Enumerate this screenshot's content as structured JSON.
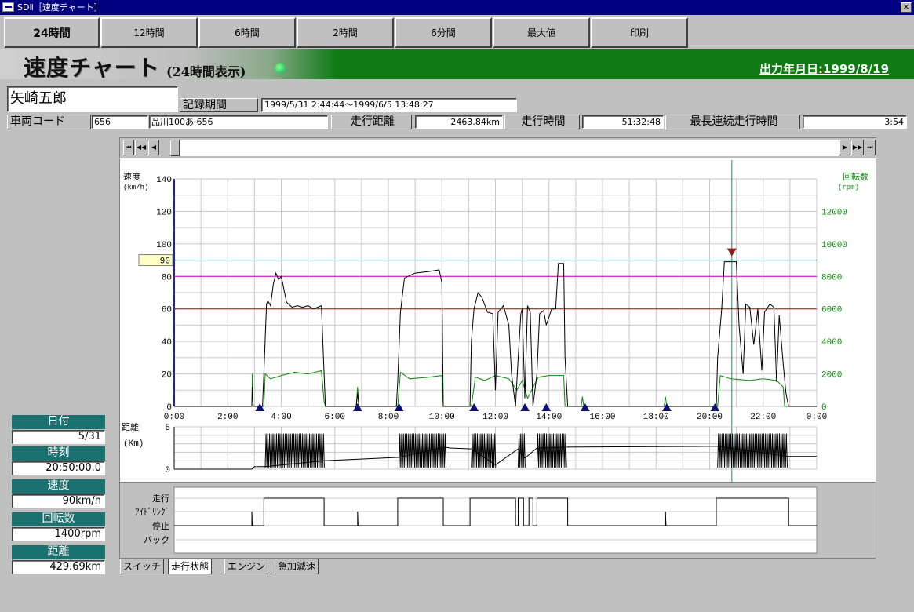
{
  "window": {
    "title": "SDⅡ［速度チャート］",
    "close": "×"
  },
  "toolbar": {
    "buttons": [
      "24時間",
      "12時間",
      "6時間",
      "2時間",
      "6分間",
      "最大値",
      "印刷"
    ],
    "active_index": 0
  },
  "banner": {
    "title": "速度チャート",
    "subtitle": "(24時間表示)",
    "output_date": "出力年月日:1999/8/19"
  },
  "record": {
    "driver_name": "矢崎五郎",
    "period_label": "記録期間",
    "period_value": "1999/5/31 2:44:44～1999/6/5 13:48:27",
    "vehicle_code_label": "車両コード",
    "vehicle_code": "656",
    "plate": "品川100あ 656",
    "distance_label": "走行距離",
    "distance_value": "2463.84km",
    "drive_time_label": "走行時間",
    "drive_time_value": "51:32:48",
    "max_continuous_label": "最長連続走行時間",
    "max_continuous_value": "3:54"
  },
  "side_info": {
    "date_label": "日付",
    "date_value": "5/31",
    "time_label": "時刻",
    "time_value": "20:50:00.0",
    "speed_label": "速度",
    "speed_value": "90km/h",
    "rpm_label": "回転数",
    "rpm_value": "1400rpm",
    "distance_label": "距離",
    "distance_value": "429.69km"
  },
  "chart_data": {
    "type": "line",
    "left_axis": {
      "label": "速度",
      "unit": "(km/h)",
      "ticks": [
        0,
        20,
        40,
        60,
        80,
        100,
        120,
        140
      ],
      "range": [
        0,
        140
      ]
    },
    "right_axis": {
      "label": "回転数",
      "unit": "(rpm)",
      "ticks": [
        0,
        2000,
        4000,
        6000,
        8000,
        10000,
        12000
      ],
      "range": [
        0,
        14000
      ]
    },
    "x_ticks": [
      "0:00",
      "2:00",
      "4:00",
      "6:00",
      "8:00",
      "10:00",
      "12:00",
      "14:00",
      "16:00",
      "18:00",
      "20:00",
      "22:00",
      "0:00"
    ],
    "x_range_hours": [
      0,
      24
    ],
    "threshold_lines": [
      {
        "value": 90,
        "color": "#2a8080"
      },
      {
        "value": 80,
        "color": "#cc00cc"
      },
      {
        "value": 60,
        "color": "#cc0000"
      }
    ],
    "marker_value": "90",
    "cursor_hour": 20.83,
    "start_markers_hours": [
      3.2,
      6.85,
      8.4,
      11.2,
      13.1,
      13.9,
      15.35,
      18.4,
      20.2
    ],
    "speed_series": [
      [
        0,
        0
      ],
      [
        2.9,
        0
      ],
      [
        2.92,
        12
      ],
      [
        2.95,
        0
      ],
      [
        3.3,
        0
      ],
      [
        3.35,
        20
      ],
      [
        3.45,
        63
      ],
      [
        3.5,
        65
      ],
      [
        3.6,
        62
      ],
      [
        3.7,
        75
      ],
      [
        3.8,
        82
      ],
      [
        3.9,
        78
      ],
      [
        4.0,
        80
      ],
      [
        4.1,
        72
      ],
      [
        4.2,
        64
      ],
      [
        4.4,
        61
      ],
      [
        4.6,
        62
      ],
      [
        4.8,
        61
      ],
      [
        5.0,
        62
      ],
      [
        5.2,
        60
      ],
      [
        5.5,
        62
      ],
      [
        5.6,
        20
      ],
      [
        5.65,
        0
      ],
      [
        6.8,
        0
      ],
      [
        6.85,
        8
      ],
      [
        6.9,
        0
      ],
      [
        8.3,
        0
      ],
      [
        8.35,
        15
      ],
      [
        8.45,
        58
      ],
      [
        8.6,
        79
      ],
      [
        9.0,
        82
      ],
      [
        9.5,
        83
      ],
      [
        9.9,
        84
      ],
      [
        10.0,
        76
      ],
      [
        10.05,
        0
      ],
      [
        11.05,
        0
      ],
      [
        11.1,
        40
      ],
      [
        11.2,
        60
      ],
      [
        11.35,
        70
      ],
      [
        11.5,
        67
      ],
      [
        11.7,
        58
      ],
      [
        11.9,
        57
      ],
      [
        12.0,
        10
      ],
      [
        12.1,
        58
      ],
      [
        12.3,
        62
      ],
      [
        12.5,
        50
      ],
      [
        12.6,
        20
      ],
      [
        12.75,
        0
      ],
      [
        12.85,
        30
      ],
      [
        12.95,
        57
      ],
      [
        13.0,
        60
      ],
      [
        13.1,
        5
      ],
      [
        13.2,
        62
      ],
      [
        13.3,
        58
      ],
      [
        13.4,
        0
      ],
      [
        13.55,
        20
      ],
      [
        13.65,
        57
      ],
      [
        13.8,
        59
      ],
      [
        13.9,
        50
      ],
      [
        14.1,
        60
      ],
      [
        14.25,
        60
      ],
      [
        14.35,
        88
      ],
      [
        14.55,
        88
      ],
      [
        14.6,
        30
      ],
      [
        14.7,
        0
      ],
      [
        15.2,
        0
      ],
      [
        15.25,
        0
      ],
      [
        20.25,
        0
      ],
      [
        20.3,
        30
      ],
      [
        20.45,
        60
      ],
      [
        20.55,
        89
      ],
      [
        21.0,
        89
      ],
      [
        21.1,
        50
      ],
      [
        21.25,
        20
      ],
      [
        21.35,
        63
      ],
      [
        21.5,
        61
      ],
      [
        21.65,
        38
      ],
      [
        21.8,
        60
      ],
      [
        21.95,
        22
      ],
      [
        22.05,
        58
      ],
      [
        22.25,
        63
      ],
      [
        22.4,
        61
      ],
      [
        22.5,
        15
      ],
      [
        22.6,
        56
      ],
      [
        22.75,
        26
      ],
      [
        22.85,
        8
      ],
      [
        22.95,
        0
      ],
      [
        24,
        0
      ]
    ],
    "rpm_series": [
      [
        0,
        0
      ],
      [
        2.9,
        0
      ],
      [
        2.92,
        2000
      ],
      [
        2.95,
        0
      ],
      [
        3.35,
        0
      ],
      [
        3.4,
        2000
      ],
      [
        3.6,
        1700
      ],
      [
        4.0,
        1900
      ],
      [
        4.5,
        2100
      ],
      [
        5.0,
        2000
      ],
      [
        5.5,
        2200
      ],
      [
        5.6,
        300
      ],
      [
        5.65,
        0
      ],
      [
        6.8,
        0
      ],
      [
        6.85,
        1200
      ],
      [
        6.9,
        0
      ],
      [
        8.35,
        0
      ],
      [
        8.45,
        2100
      ],
      [
        8.8,
        1700
      ],
      [
        9.5,
        1800
      ],
      [
        10.0,
        1900
      ],
      [
        10.05,
        0
      ],
      [
        11.1,
        0
      ],
      [
        11.25,
        1800
      ],
      [
        11.6,
        1600
      ],
      [
        12.0,
        1900
      ],
      [
        12.5,
        1700
      ],
      [
        12.8,
        1000
      ],
      [
        13.0,
        1600
      ],
      [
        13.2,
        500
      ],
      [
        13.6,
        1800
      ],
      [
        14.0,
        1900
      ],
      [
        14.55,
        1900
      ],
      [
        14.6,
        0
      ],
      [
        15.2,
        0
      ],
      [
        15.25,
        600
      ],
      [
        15.3,
        0
      ],
      [
        18.3,
        0
      ],
      [
        18.35,
        600
      ],
      [
        18.4,
        0
      ],
      [
        20.3,
        0
      ],
      [
        20.4,
        1900
      ],
      [
        20.8,
        1700
      ],
      [
        21.5,
        1600
      ],
      [
        22.0,
        1700
      ],
      [
        22.5,
        1600
      ],
      [
        22.75,
        1200
      ],
      [
        22.8,
        0
      ],
      [
        24,
        0
      ]
    ],
    "distance_axis": {
      "label": "距離",
      "unit": "(Km)",
      "ticks": [
        0,
        5
      ],
      "range": [
        0,
        5
      ]
    },
    "distance_bursts": [
      [
        3.4,
        5.6
      ],
      [
        8.4,
        10.1
      ],
      [
        11.1,
        12.0
      ],
      [
        12.85,
        13.1
      ],
      [
        13.55,
        14.6
      ],
      [
        20.3,
        22.9
      ]
    ],
    "distance_steps": [
      [
        0,
        0
      ],
      [
        2.9,
        0
      ],
      [
        3.0,
        0.3
      ],
      [
        3.4,
        0.3
      ],
      [
        5.6,
        1.0
      ],
      [
        8.4,
        1.4
      ],
      [
        10.1,
        2.6
      ],
      [
        10.3,
        2.5
      ],
      [
        11.1,
        2.4
      ],
      [
        12.0,
        0.5
      ],
      [
        12.85,
        2.4
      ],
      [
        13.1,
        1.3
      ],
      [
        13.55,
        2.5
      ],
      [
        14.6,
        2.6
      ],
      [
        20.3,
        2.7
      ],
      [
        22.9,
        1.5
      ],
      [
        24,
        1.5
      ]
    ],
    "state_labels": [
      "走行",
      "ｱｲﾄﾞﾘﾝｸﾞ",
      "停止",
      "バック"
    ],
    "state_series": [
      [
        0,
        2
      ],
      [
        2.9,
        2
      ],
      [
        2.9,
        1
      ],
      [
        2.92,
        2
      ],
      [
        3.35,
        2
      ],
      [
        3.35,
        0
      ],
      [
        5.6,
        0
      ],
      [
        5.6,
        2
      ],
      [
        6.85,
        2
      ],
      [
        6.85,
        1
      ],
      [
        6.87,
        2
      ],
      [
        8.35,
        2
      ],
      [
        8.35,
        0
      ],
      [
        10.05,
        0
      ],
      [
        10.05,
        2
      ],
      [
        11.05,
        2
      ],
      [
        11.05,
        0
      ],
      [
        12.75,
        0
      ],
      [
        12.75,
        2
      ],
      [
        12.85,
        2
      ],
      [
        12.85,
        0
      ],
      [
        13.05,
        0
      ],
      [
        13.05,
        2
      ],
      [
        13.25,
        2
      ],
      [
        13.25,
        0
      ],
      [
        13.4,
        0
      ],
      [
        13.4,
        2
      ],
      [
        13.55,
        2
      ],
      [
        13.55,
        0
      ],
      [
        14.7,
        0
      ],
      [
        14.7,
        2
      ],
      [
        18.35,
        2
      ],
      [
        18.35,
        1
      ],
      [
        18.37,
        2
      ],
      [
        20.25,
        2
      ],
      [
        20.25,
        0
      ],
      [
        22.95,
        0
      ],
      [
        22.95,
        2
      ],
      [
        24,
        2
      ]
    ]
  },
  "tabs": [
    "スイッチ",
    "走行状態",
    "エンジン",
    "急加減速"
  ],
  "active_tab": 1,
  "scrollbar": {
    "btn_first": "⏮",
    "btn_prev_page": "◀◀",
    "btn_prev": "◀",
    "btn_next": "▶",
    "btn_next_page": "▶▶",
    "btn_last": "⏭"
  }
}
